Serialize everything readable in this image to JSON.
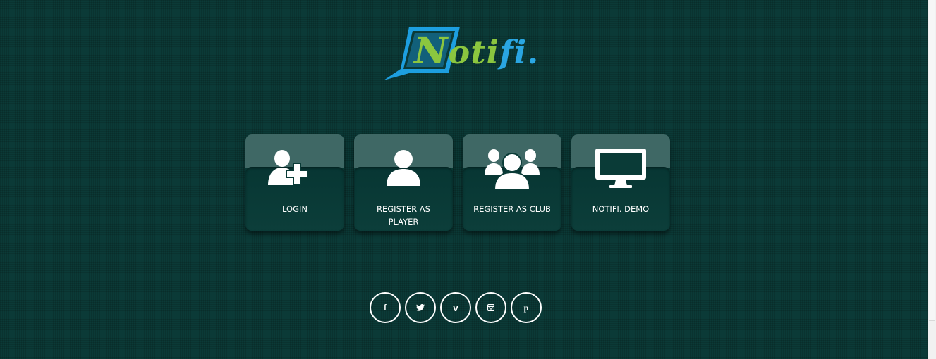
{
  "brand": {
    "logo_letters": {
      "n": "N",
      "otifi": "oti",
      "fi": "fi",
      "dot": "."
    },
    "colors": {
      "green": "#8bc63f",
      "blue": "#2aa6e2",
      "background": "#0b3a37"
    }
  },
  "tiles": [
    {
      "label": "LOGIN",
      "icon": "add-user-icon"
    },
    {
      "label": "REGISTER AS PLAYER",
      "icon": "user-icon"
    },
    {
      "label": "REGISTER AS CLUB",
      "icon": "group-icon"
    },
    {
      "label": "NOTIFI. DEMO",
      "icon": "monitor-icon"
    }
  ],
  "social": [
    {
      "glyph": "f",
      "icon": "facebook-icon"
    },
    {
      "glyph": "t",
      "icon": "twitter-icon"
    },
    {
      "glyph": "v",
      "icon": "vimeo-icon"
    },
    {
      "glyph": "",
      "icon": "instagram-icon"
    },
    {
      "glyph": "p",
      "icon": "pinterest-icon"
    }
  ]
}
